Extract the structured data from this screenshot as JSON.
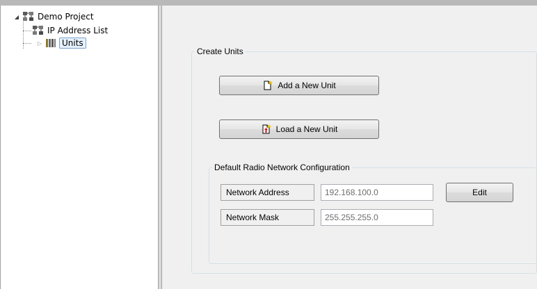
{
  "tree": {
    "root": {
      "label": "Demo Project",
      "icon": "network-project-icon",
      "expanded": true
    },
    "children": [
      {
        "label": "IP Address List",
        "icon": "network-project-icon"
      },
      {
        "label": "Units",
        "icon": "units-rack-icon",
        "expanded": false,
        "selected": true
      }
    ]
  },
  "create_units": {
    "title": "Create Units",
    "add_button": {
      "label": "Add a New Unit",
      "icon": "new-document-icon"
    },
    "load_button": {
      "label": "Load a New Unit",
      "icon": "load-document-icon"
    }
  },
  "radio_config": {
    "title": "Default Radio Network Configuration",
    "network_address": {
      "label": "Network Address",
      "value": "192.168.100.0"
    },
    "network_mask": {
      "label": "Network Mask",
      "value": "255.255.255.0"
    },
    "edit_label": "Edit"
  },
  "colors": {
    "panel_background": "#f0f0f0",
    "selection": "#e5f1fb",
    "selection_border": "#7da2ce"
  }
}
